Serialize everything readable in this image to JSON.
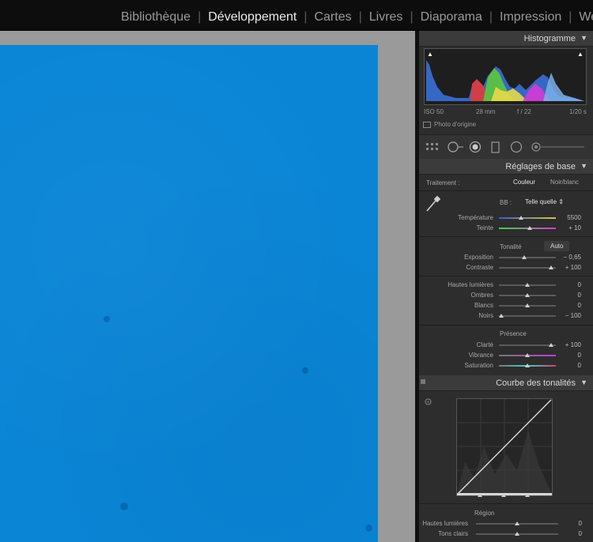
{
  "modules": [
    "Bibliothèque",
    "Développement",
    "Cartes",
    "Livres",
    "Diaporama",
    "Impression",
    "We"
  ],
  "active_module": "Développement",
  "histogram": {
    "title": "Histogramme",
    "exif": {
      "iso": "ISO 50",
      "focal": "28 mm",
      "aperture": "f / 22",
      "shutter_num": "1",
      "shutter_den": "20",
      "shutter_unit": "s"
    },
    "original_photo": "Photo d'origine"
  },
  "basic": {
    "title": "Réglages de base",
    "treatment_label": "Traitement :",
    "color": "Couleur",
    "bw": "Noir/blanc",
    "wb_label": "BB :",
    "wb_value": "Telle quelle",
    "temperature_label": "Température",
    "temperature_value": "5500",
    "tint_label": "Teinte",
    "tint_value": "+ 10",
    "tone_label": "Tonalité",
    "auto_label": "Auto",
    "exposure_label": "Exposition",
    "exposure_value": "− 0,65",
    "contrast_label": "Contraste",
    "contrast_value": "+ 100",
    "highlights_label": "Hautes lumières",
    "highlights_value": "0",
    "shadows_label": "Ombres",
    "shadows_value": "0",
    "whites_label": "Blancs",
    "whites_value": "0",
    "blacks_label": "Noirs",
    "blacks_value": "− 100",
    "presence_label": "Présence",
    "clarity_label": "Clarté",
    "clarity_value": "+ 100",
    "vibrance_label": "Vibrance",
    "vibrance_value": "0",
    "saturation_label": "Saturation",
    "saturation_value": "0"
  },
  "curve": {
    "title": "Courbe des tonalités",
    "region_label": "Région",
    "highlights_label": "Hautes lumières",
    "highlights_value": "0",
    "lights_label": "Tons clairs",
    "lights_value": "0"
  },
  "colors": {
    "photo_blue": "#0a85d6",
    "panel_bg": "#2d2d2d",
    "accent": "#ececec"
  }
}
